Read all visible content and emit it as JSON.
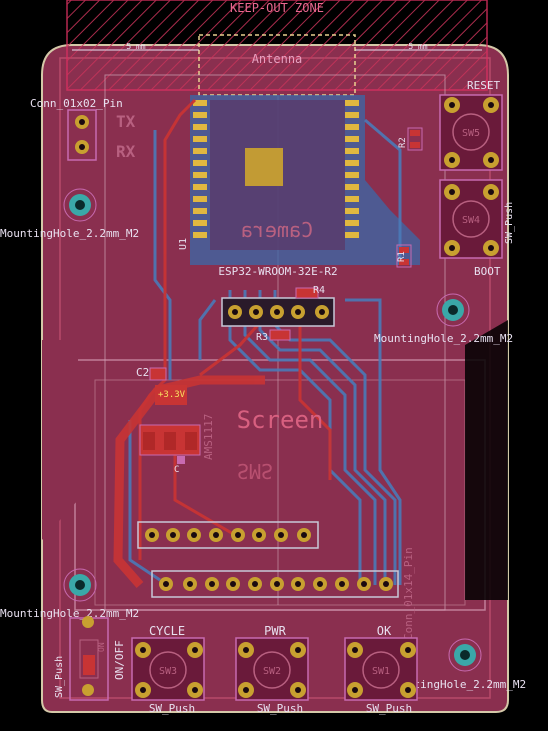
{
  "keepout_label": "KEEP-OUT ZONE",
  "antenna_label": "Antenna",
  "dim_left": "5 mm",
  "dim_right": "5 mm",
  "conn_header_label": "Conn_01x02_Pin",
  "tx_label": "TX",
  "rx_label": "RX",
  "reset_label": "RESET",
  "boot_label": "BOOT",
  "camera_label": "Camera",
  "module_label": "ESP32-WROOM-32E-R2",
  "u1_label": "U1",
  "r1_label": "R1",
  "r2_label": "R2",
  "r3_label": "R3",
  "r4_label": "R4",
  "c2_label": "C2",
  "c_small_label": "C",
  "v33_label": "+3.3V",
  "ams_label": "AMS1117",
  "screen_label": "Screen",
  "sms_label": "SMS",
  "sw4_label": "SW4",
  "sw5_label": "SW5",
  "sw_push_side": "SW_Push",
  "mh_label": "MountingHole_2.2mm_M2",
  "conn_1x14_label": "Conn_01x14_Pin",
  "sw_push_left": "SW_Push",
  "on_off_label": "ON/OFF",
  "on_label": "ON",
  "cycle_label": "CYCLE",
  "pwr_label": "PWR",
  "ok_label": "OK",
  "sw1_label": "SW1",
  "sw2_label": "SW2",
  "sw3_label": "SW3",
  "sw_push_bottom": "SW_Push",
  "colors": {
    "board": "#8a2f4f",
    "edge": "#d4c8a8",
    "copper_front": "#c83434",
    "copper_back": "#4a7ab8",
    "pad": "#c8a030",
    "silk": "#e8e0c0",
    "fab": "#c86ab0",
    "mounting": "#3aa8a8"
  }
}
